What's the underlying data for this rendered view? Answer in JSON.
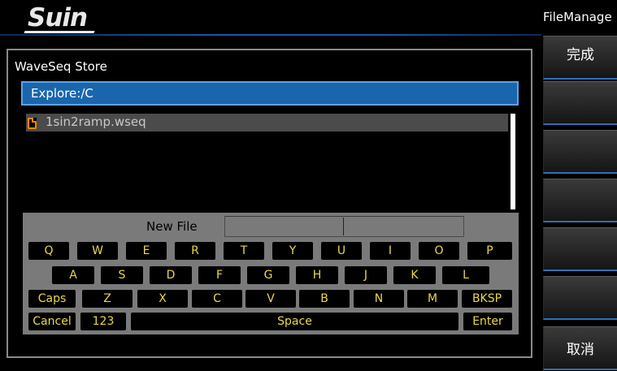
{
  "header": {
    "logo": "Suin"
  },
  "menu": {
    "title": "FileManage",
    "softkeys": [
      "完成",
      "",
      "",
      "",
      "",
      "",
      "取消"
    ]
  },
  "dialog": {
    "title": "WaveSeq Store",
    "explore_path": "Explore:/C",
    "files": [
      "1sin2ramp.wseq"
    ]
  },
  "keyboard": {
    "new_file_label": "New File",
    "new_file_value": "",
    "row1": [
      "Q",
      "W",
      "E",
      "R",
      "T",
      "Y",
      "U",
      "I",
      "O",
      "P"
    ],
    "row2": [
      "A",
      "S",
      "D",
      "F",
      "G",
      "H",
      "J",
      "K",
      "L"
    ],
    "row3": [
      "Caps",
      "Z",
      "X",
      "C",
      "V",
      "B",
      "N",
      "M",
      "BKSP"
    ],
    "row4": [
      "Cancel",
      "123",
      "Space",
      "Enter"
    ]
  },
  "colors": {
    "accent_blue": "#1a66ad",
    "key_text": "#e9d84a",
    "file_icon": "#e68a00"
  }
}
